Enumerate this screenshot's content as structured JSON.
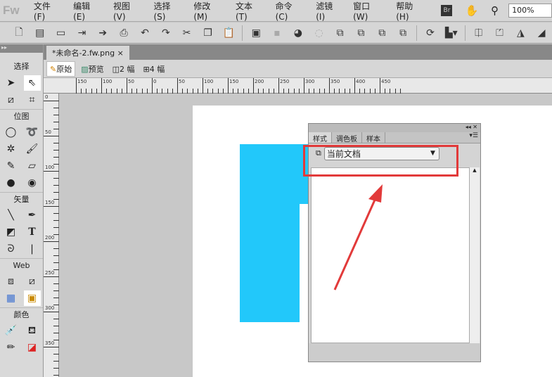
{
  "app": {
    "logo": "Fw",
    "menus": [
      "文件(F)",
      "编辑(E)",
      "视图(V)",
      "选择(S)",
      "修改(M)",
      "文本(T)",
      "命令(C)",
      "滤镜(I)",
      "窗口(W)",
      "帮助(H)"
    ],
    "bridge": "Br",
    "zoom": "100%"
  },
  "toolbar": {
    "icons": [
      "new",
      "save",
      "open",
      "import",
      "export",
      "print",
      "undo",
      "redo",
      "cut",
      "copy",
      "paste",
      "group",
      "ungroup",
      "join",
      "split",
      "bring-front",
      "bring-forward",
      "send-backward",
      "send-back",
      "rotate",
      "align",
      "flip-h",
      "flip-v",
      "mirror",
      "skew"
    ]
  },
  "tools": {
    "sections": [
      {
        "label": "选择"
      },
      {
        "label": "位图"
      },
      {
        "label": "矢量"
      },
      {
        "label": "Web"
      },
      {
        "label": "颜色"
      }
    ]
  },
  "document": {
    "tab": "*未命名-2.fw.png",
    "close": "×"
  },
  "views": {
    "original": "原始",
    "preview": "预览",
    "two": "2 幅",
    "four": "4 幅"
  },
  "ruler": {
    "h_labels": [
      "150",
      "100",
      "50",
      "0",
      "50",
      "100",
      "150",
      "200",
      "250",
      "300",
      "350",
      "400",
      "450"
    ],
    "v_labels": [
      "0",
      "50",
      "100",
      "150",
      "200",
      "250",
      "300",
      "350"
    ]
  },
  "panel": {
    "tabs": [
      "样式",
      "调色板",
      "样本"
    ],
    "select_value": "当前文档"
  },
  "colors": {
    "shape": "#22c8fa",
    "highlight": "#e23a3a"
  }
}
